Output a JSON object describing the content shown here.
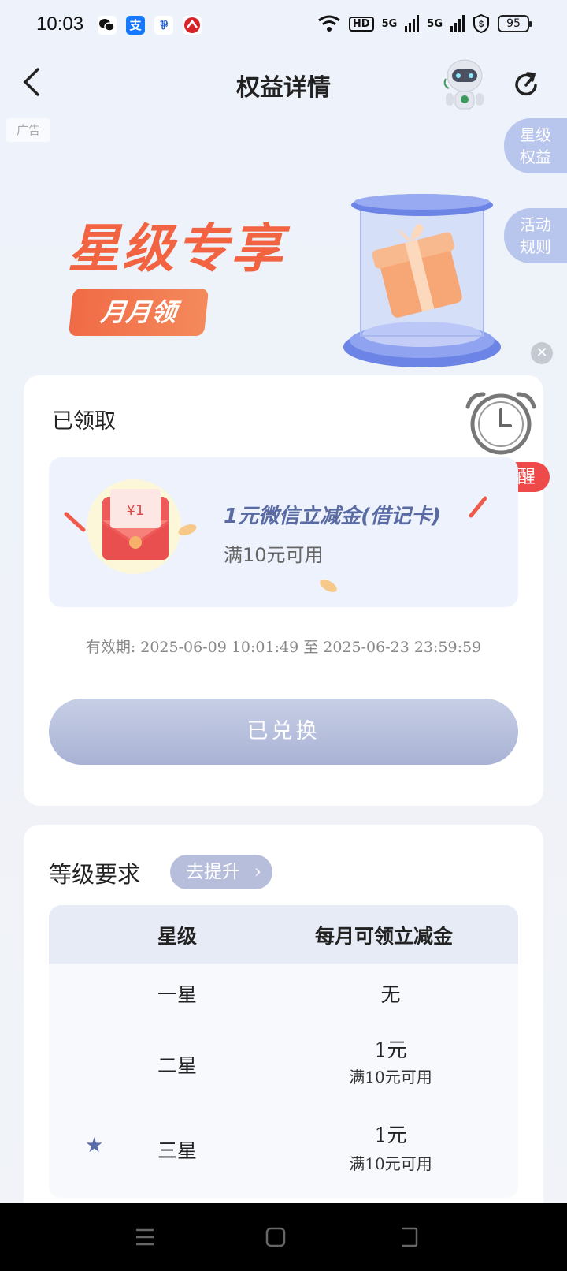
{
  "status_bar": {
    "time": "10:03",
    "battery": "95",
    "network": [
      "HD",
      "5G",
      "5G"
    ],
    "app_icons": [
      "wechat-icon",
      "alipay-icon",
      "bank-app-icon",
      "cmb-icon"
    ]
  },
  "nav": {
    "title": "权益详情",
    "back_icon": "chevron-left-icon",
    "refresh_icon": "refresh-icon"
  },
  "ad": {
    "label": "广告"
  },
  "side_tabs": [
    {
      "line1": "星级",
      "line2": "权益"
    },
    {
      "line1": "活动",
      "line2": "规则"
    }
  ],
  "banner": {
    "title": "星级专享",
    "badge": "月月领"
  },
  "claimed": {
    "label": "已领取",
    "remind_button": "添加提醒",
    "coupon_title": "1元微信立减金(借记卡)",
    "coupon_condition": "满10元可用",
    "coupon_art_amount": "¥1",
    "validity": "有效期: 2025-06-09 10:01:49 至 2025-06-23 23:59:59",
    "redeemed_button": "已兑换"
  },
  "requirements": {
    "title": "等级要求",
    "upgrade_button": "去提升",
    "columns": [
      "星级",
      "每月可领立减金"
    ],
    "rows": [
      {
        "star": "一星",
        "amount": "无",
        "condition": "",
        "current": false
      },
      {
        "star": "二星",
        "amount": "1元",
        "condition": "满10元可用",
        "current": false
      },
      {
        "star": "三星",
        "amount": "1元",
        "condition": "满10元可用",
        "current": true
      }
    ]
  },
  "colors": {
    "accent": "#f26342",
    "button_blue": "#b6bedc",
    "remind_red": "#ef4a4a",
    "coupon_title": "#5a6aa2"
  }
}
